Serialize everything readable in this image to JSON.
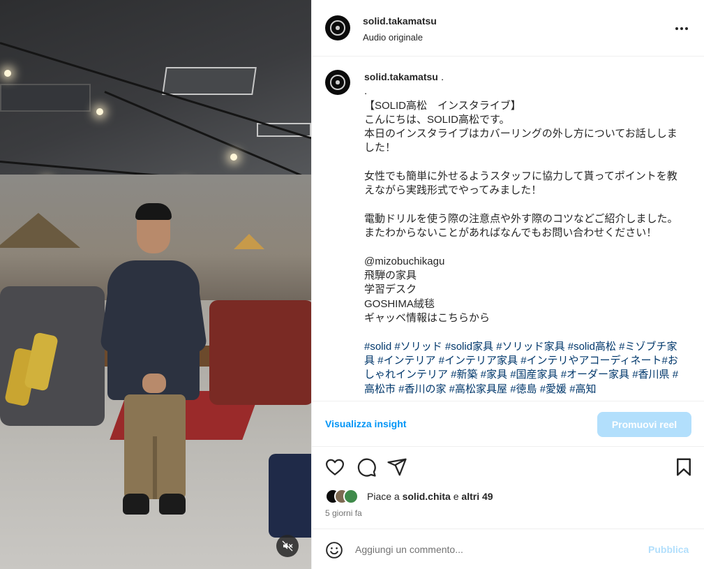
{
  "post": {
    "username": "solid.takamatsu",
    "audio": "Audio originale"
  },
  "caption": {
    "username": "solid.takamatsu",
    "text": " .\n.\n【SOLID高松　インスタライブ】\nこんにちは、SOLID高松です。\n本日のインスタライブはカバーリングの外し方についてお話ししました！\n\n女性でも簡単に外せるようスタッフに協力して貰ってポイントを教えながら実践形式でやってみました！\n\n電動ドリルを使う際の注意点や外す際のコツなどご紹介しました。\nまたわからないことがあればなんでもお問い合わせください！\n\n@mizobuchikagu\n飛騨の家具\n学習デスク\nGOSHIMA絨毯\nギャッベ情報はこちらから\n\n",
    "hashtags": "#solid #ソリッド #solid家具 #ソリッド家具 #solid高松 #ミゾブチ家具 #インテリア #インテリア家具 #インテリやアコーディネート#おしゃれインテリア #新築 #家具 #国産家具 #オーダー家具 #香川県 #高松市 #香川の家 #高松家具屋 #徳島 #愛媛 #高知"
  },
  "insights": {
    "link_label": "Visualizza insight",
    "promote_label": "Promuovi reel"
  },
  "likes": {
    "prefix": "Piace a ",
    "user": "solid.chita",
    "middle": " e ",
    "others": "altri 49"
  },
  "date": "5 giorni fa",
  "comment": {
    "placeholder": "Aggiungi un commento...",
    "publish_label": "Pubblica"
  },
  "icons": {
    "mute": "speaker-muted-icon",
    "more": "more-horizontal-icon",
    "like": "heart-icon",
    "comment": "comment-icon",
    "share": "paper-plane-icon",
    "save": "bookmark-icon",
    "emoji": "smiley-icon"
  },
  "colors": {
    "link": "#0095f6",
    "button_disabled": "#b2dffc",
    "hashtag": "#00376b",
    "secondary_text": "#737373"
  }
}
